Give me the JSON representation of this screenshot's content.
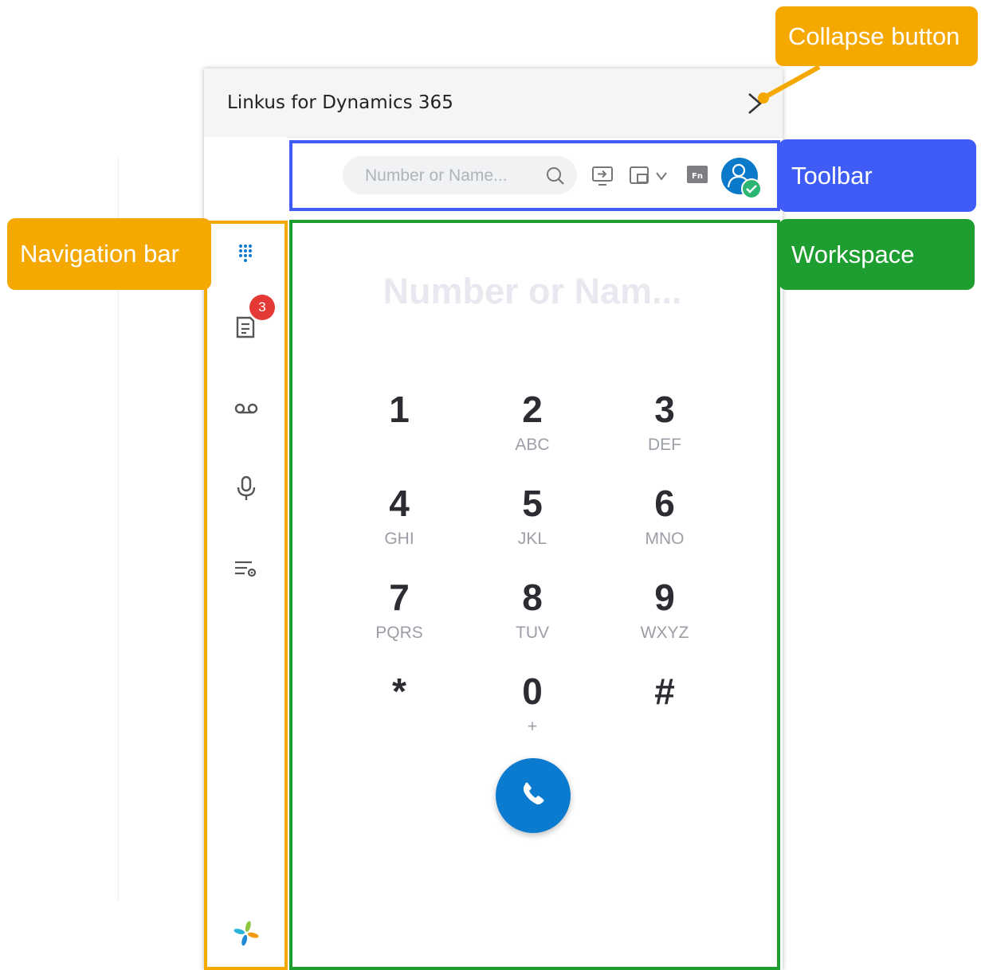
{
  "app": {
    "title": "Linkus for Dynamics 365"
  },
  "toolbar": {
    "search_placeholder": "Number or Name...",
    "icons": [
      "screen-share-icon",
      "device-select-icon",
      "fn-key-icon",
      "user-avatar-icon"
    ]
  },
  "navigation": {
    "items": [
      "dialpad-icon",
      "call-log-icon",
      "voicemail-icon",
      "recording-icon",
      "settings-list-icon"
    ],
    "unread_badge": "3",
    "logo": "yeastar-logo-icon"
  },
  "workspace": {
    "display_placeholder": "Number or Nam...",
    "keys": [
      {
        "digit": "1",
        "letters": ""
      },
      {
        "digit": "2",
        "letters": "ABC"
      },
      {
        "digit": "3",
        "letters": "DEF"
      },
      {
        "digit": "4",
        "letters": "GHI"
      },
      {
        "digit": "5",
        "letters": "JKL"
      },
      {
        "digit": "6",
        "letters": "MNO"
      },
      {
        "digit": "7",
        "letters": "PQRS"
      },
      {
        "digit": "8",
        "letters": "TUV"
      },
      {
        "digit": "9",
        "letters": "WXYZ"
      },
      {
        "digit": "*",
        "letters": ""
      },
      {
        "digit": "0",
        "letters": "+"
      },
      {
        "digit": "#",
        "letters": ""
      }
    ]
  },
  "annotations": {
    "collapse_button": "Collapse button",
    "toolbar": "Toolbar",
    "navigation_bar": "Navigation bar",
    "workspace": "Workspace"
  },
  "colors": {
    "accent_blue": "#0b7bd0",
    "badge_red": "#e53935",
    "status_green": "#2bb673",
    "annotation_orange": "#f5a800",
    "annotation_blue": "#3f5cf6",
    "annotation_green": "#1e9e30"
  }
}
